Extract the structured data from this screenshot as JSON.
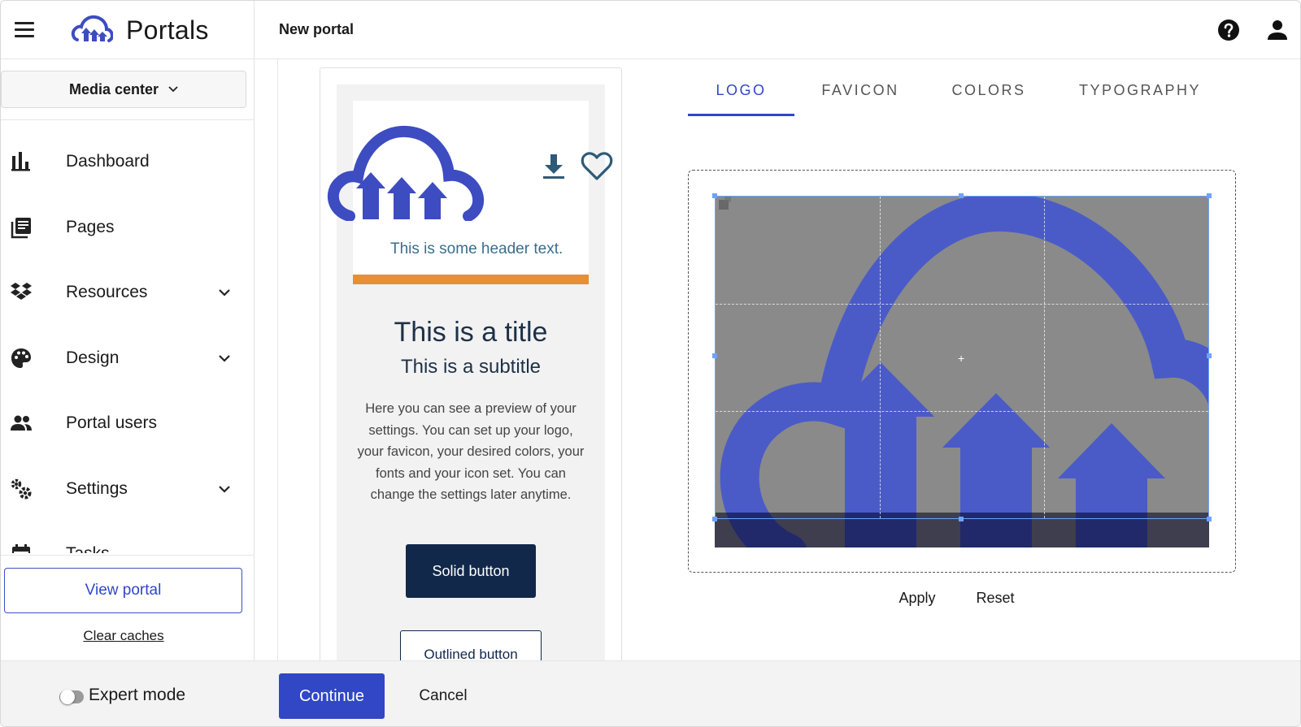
{
  "app": {
    "name": "Portals",
    "menu_icon": "hamburger-menu-icon",
    "logo_icon": "cloud-upload-logo",
    "brand_color": "#3147c6"
  },
  "header": {
    "title": "New portal",
    "help_icon": "help-circle-icon",
    "user_icon": "account-icon"
  },
  "sidebar": {
    "workspace": "Media center",
    "items": [
      {
        "label": "Dashboard",
        "icon": "bar-chart-icon",
        "expandable": false
      },
      {
        "label": "Pages",
        "icon": "pages-icon",
        "expandable": false
      },
      {
        "label": "Resources",
        "icon": "dropbox-icon",
        "expandable": true
      },
      {
        "label": "Design",
        "icon": "palette-icon",
        "expandable": true
      },
      {
        "label": "Portal users",
        "icon": "people-icon",
        "expandable": false
      },
      {
        "label": "Settings",
        "icon": "gears-icon",
        "expandable": true
      },
      {
        "label": "Tasks",
        "icon": "calendar-icon",
        "expandable": false
      }
    ],
    "view_portal": "View portal",
    "clear_caches": "Clear caches",
    "expert_mode": "Expert mode"
  },
  "preview": {
    "header_text": "This is some header text.",
    "title": "This is a title",
    "subtitle": "This is a subtitle",
    "body": "Here you can see a preview of your settings. You can set up your logo, your favicon, your desired colors, your fonts and your icon set. You can change the settings later anytime.",
    "solid_button": "Solid button",
    "outlined_button": "Outlined button",
    "accent_bar_color": "#e59034",
    "text_color": "#1d3147",
    "logo_color": "#3d4cc1"
  },
  "tabs": [
    {
      "label": "LOGO",
      "active": true
    },
    {
      "label": "FAVICON",
      "active": false
    },
    {
      "label": "COLORS",
      "active": false
    },
    {
      "label": "TYPOGRAPHY",
      "active": false
    }
  ],
  "cropper": {
    "apply": "Apply",
    "reset": "Reset"
  },
  "footer": {
    "continue": "Continue",
    "cancel": "Cancel"
  }
}
